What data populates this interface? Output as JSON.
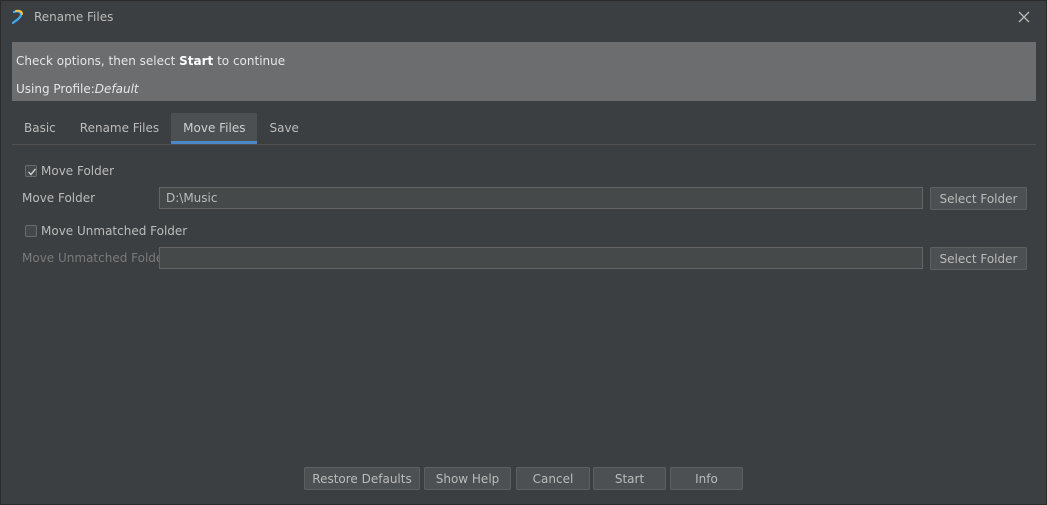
{
  "window": {
    "title": "Rename Files"
  },
  "info": {
    "line1_prefix": "Check options, then select ",
    "line1_bold": "Start",
    "line1_suffix": " to continue",
    "profile_prefix": "Using Profile:",
    "profile_name": "Default"
  },
  "tabs": [
    {
      "label": "Basic",
      "active": false
    },
    {
      "label": "Rename Files",
      "active": false
    },
    {
      "label": "Move Files",
      "active": true
    },
    {
      "label": "Save",
      "active": false
    }
  ],
  "move_files": {
    "move_folder_checkbox": {
      "label": "Move Folder",
      "checked": true
    },
    "move_folder_field": {
      "label": "Move Folder",
      "value": "D:\\Music"
    },
    "move_unmatched_checkbox": {
      "label": "Move Unmatched Folder",
      "checked": false
    },
    "move_unmatched_field": {
      "label": "Move Unmatched Folder",
      "value": ""
    },
    "select_folder_label": "Select Folder"
  },
  "footer": {
    "restore_defaults": "Restore Defaults",
    "show_help": "Show Help",
    "cancel": "Cancel",
    "start": "Start",
    "info": "Info"
  },
  "colors": {
    "background": "#3c3f41",
    "info_panel": "#6b6d6e",
    "active_tab_accent": "#4a88c7"
  }
}
